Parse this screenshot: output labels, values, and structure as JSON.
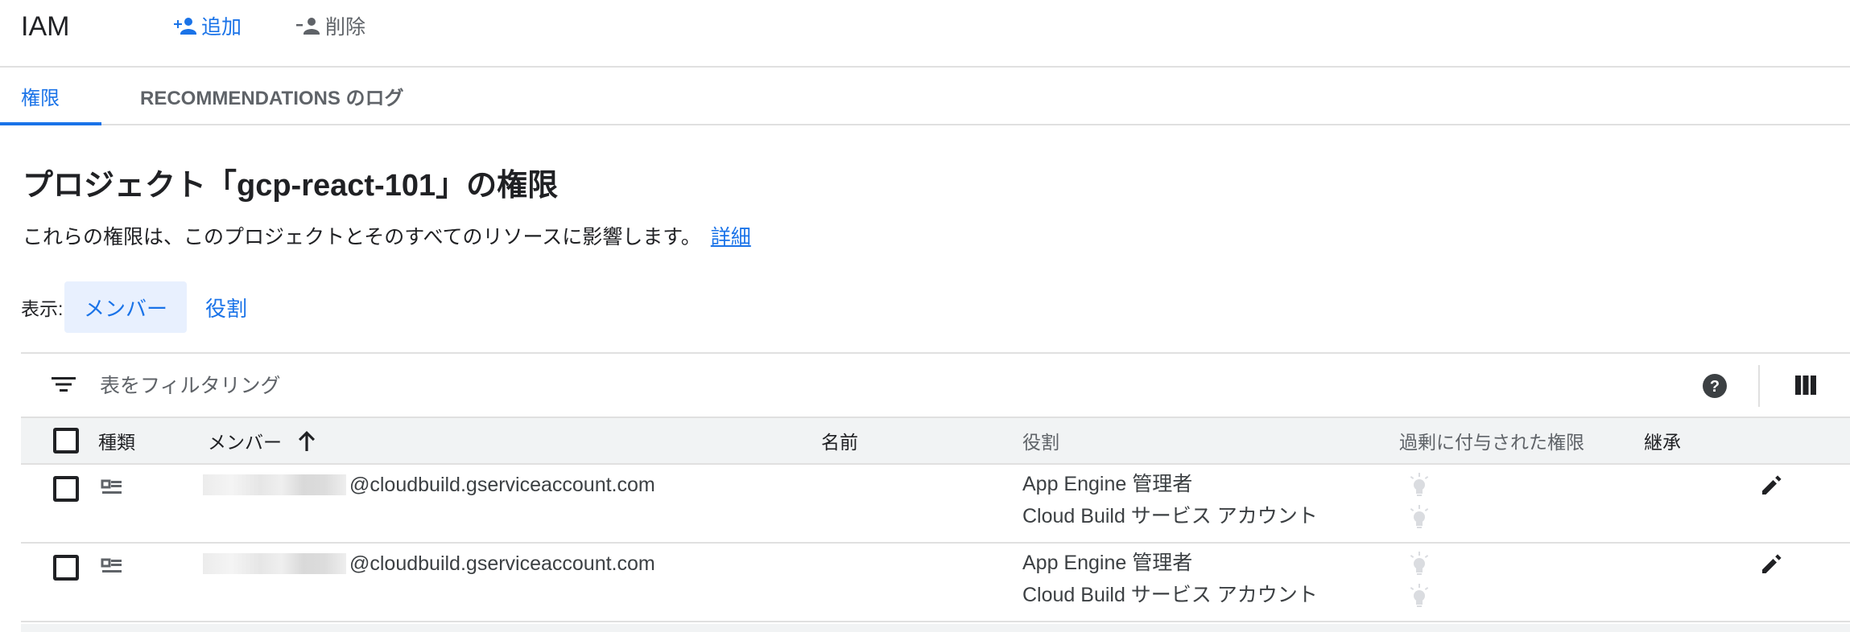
{
  "header": {
    "title": "IAM",
    "add_label": "追加",
    "remove_label": "削除"
  },
  "tabs": [
    {
      "label": "権限",
      "active": true
    },
    {
      "label": "RECOMMENDATIONS のログ",
      "active": false
    }
  ],
  "page": {
    "title": "プロジェクト「gcp-react-101」の権限",
    "description": "これらの権限は、このプロジェクトとそのすべてのリソースに影響します。",
    "more_link": "詳細"
  },
  "view": {
    "label": "表示:",
    "options": [
      "メンバー",
      "役割"
    ],
    "selected": "メンバー"
  },
  "filter": {
    "placeholder": "表をフィルタリング"
  },
  "table": {
    "headers": {
      "type": "種類",
      "member": "メンバー",
      "name": "名前",
      "role": "役割",
      "excess": "過剰に付与された権限",
      "inherit": "継承"
    },
    "sort_column": "member",
    "sort_direction": "ascending",
    "rows": [
      {
        "member": "@cloudbuild.gserviceaccount.com",
        "name": "",
        "roles": [
          "App Engine 管理者",
          "Cloud Build サービス アカウント"
        ]
      },
      {
        "member": "@cloudbuild.gserviceaccount.com",
        "name": "",
        "roles": [
          "App Engine 管理者",
          "Cloud Build サービス アカウント"
        ]
      }
    ]
  },
  "icons": {
    "add": "add-person-icon",
    "remove": "remove-person-icon",
    "filter": "filter-list-icon",
    "help": "help-icon",
    "columns": "column-display-icon",
    "type": "service-account-icon",
    "excess": "lightbulb-off-icon",
    "edit": "pencil-icon",
    "sort": "arrow-up-icon"
  },
  "colors": {
    "accent": "#1a73e8",
    "text": "#202124",
    "muted": "#5f6368",
    "divider": "#e0e0e0",
    "header_bg": "#f1f3f4",
    "selected_bg": "#e8f0fe"
  }
}
